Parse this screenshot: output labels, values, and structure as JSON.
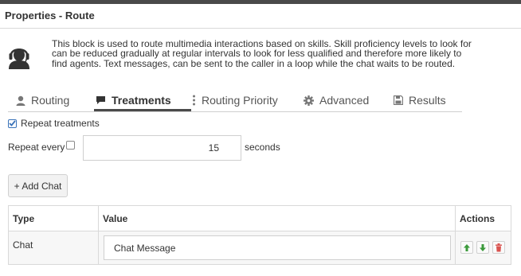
{
  "header": {
    "title": "Properties - Route"
  },
  "block": {
    "icon": "agent-headset-icon",
    "description": "This block is used to route multimedia interactions based on skills. Skill proficiency levels to look for can be reduced gradually at regular intervals to look for less qualified and therefore more likely to find agents. Text messages, can be sent to the caller in a loop while the chat waits to be routed."
  },
  "tabs": [
    {
      "label": "Routing",
      "icon": "agent-icon",
      "active": false
    },
    {
      "label": "Treatments",
      "icon": "chat-icon",
      "active": true
    },
    {
      "label": "Routing Priority",
      "icon": "vertical-dots-icon",
      "active": false
    },
    {
      "label": "Advanced",
      "icon": "gear-icon",
      "active": false
    },
    {
      "label": "Results",
      "icon": "save-icon",
      "active": false
    }
  ],
  "treatments": {
    "repeat_treatments_label": "Repeat treatments",
    "repeat_treatments_checked": true,
    "repeat_every_label": "Repeat every",
    "repeat_every_checked": false,
    "repeat_interval": "15",
    "seconds_label": "seconds",
    "add_chat_label": "+ Add Chat"
  },
  "table": {
    "columns": [
      "Type",
      "Value",
      "Actions"
    ],
    "rows": [
      {
        "type": "Chat",
        "value": "Chat Message",
        "actions": [
          "move-up-icon",
          "move-down-icon",
          "delete-icon"
        ]
      }
    ]
  },
  "colors": {
    "up_arrow": "#3c9a3c",
    "down_arrow": "#3c9a3c",
    "delete": "#d9534f",
    "checkbox": "#3b73b9"
  }
}
